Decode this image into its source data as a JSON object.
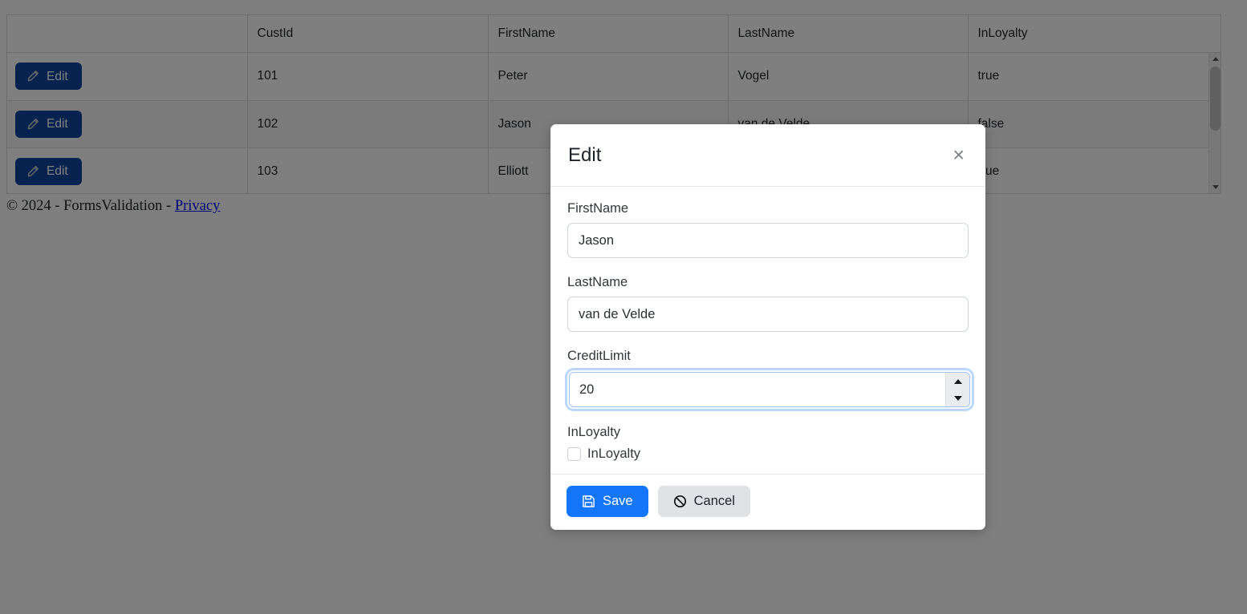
{
  "table": {
    "columns": [
      "",
      "CustId",
      "FirstName",
      "LastName",
      "InLoyalty"
    ],
    "edit_label": "Edit",
    "rows": [
      {
        "custid": "101",
        "firstname": "Peter",
        "lastname": "Vogel",
        "inloyalty": "true"
      },
      {
        "custid": "102",
        "firstname": "Jason",
        "lastname": "van de Velde",
        "inloyalty": "false"
      },
      {
        "custid": "103",
        "firstname": "Elliott",
        "lastname": "",
        "inloyalty": "true"
      }
    ],
    "scrollbar": {
      "up_icon": "caret-up-icon",
      "down_icon": "caret-down-icon"
    }
  },
  "footer": {
    "copyright": "© 2024 - FormsValidation - ",
    "privacy_link": "Privacy"
  },
  "modal": {
    "title": "Edit",
    "close_label": "×",
    "fields": {
      "firstname": {
        "label": "FirstName",
        "value": "Jason",
        "placeholder": ""
      },
      "lastname": {
        "label": "LastName",
        "value": "van de Velde",
        "placeholder": ""
      },
      "creditlimit": {
        "label": "CreditLimit",
        "value": "20",
        "placeholder": ""
      },
      "inloyalty": {
        "label": "InLoyalty",
        "checkbox_label": "InLoyalty",
        "checked": "false"
      }
    },
    "buttons": {
      "save": "Save",
      "cancel": "Cancel"
    }
  },
  "colors": {
    "edit_button": "#0d47a1",
    "save_button": "#1375fa",
    "cancel_button": "#e0e2e5",
    "focus_ring": "#0d6efd",
    "link": "#0000ee"
  }
}
